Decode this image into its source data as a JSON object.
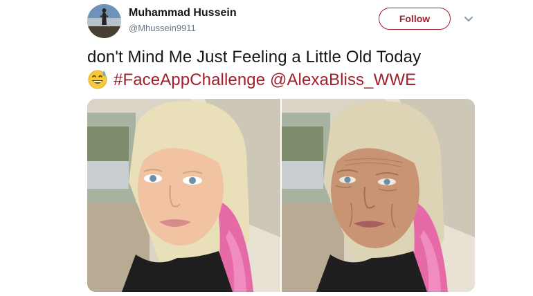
{
  "tweet": {
    "author_name": "Muhammad Hussein",
    "author_handle": "@Mhussein9911",
    "follow_label": "Follow",
    "text_line1": "don't Mind Me Just Feeling a Little Old Today",
    "hashtag": "#FaceAppChallenge",
    "mention": "@AlexaBliss_WWE",
    "emoji": "grinning-face-with-sweat-emoji"
  },
  "colors": {
    "accent": "#a01f2b",
    "text": "#14171a",
    "secondary_text": "#657786"
  },
  "media": {
    "photos": [
      {
        "name": "photo-original"
      },
      {
        "name": "photo-aged"
      }
    ]
  }
}
